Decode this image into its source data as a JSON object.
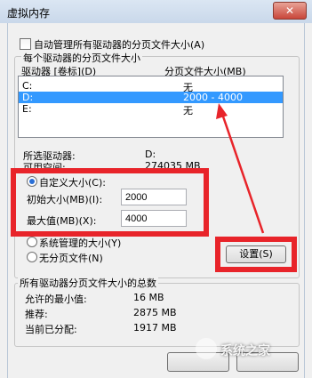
{
  "window": {
    "title": "虚拟内存",
    "close_label": "✕"
  },
  "auto_manage": {
    "label": "自动管理所有驱动器的分页文件大小(A)",
    "checked": false
  },
  "group_drives": {
    "label": "每个驱动器的分页文件大小"
  },
  "columns": {
    "drive": "驱动器 [卷标](D)",
    "size": "分页文件大小(MB)"
  },
  "drives": [
    {
      "drive": "C:",
      "size": "无",
      "selected": false
    },
    {
      "drive": "D:",
      "size": "2000 - 4000",
      "selected": true
    },
    {
      "drive": "E:",
      "size": "无",
      "selected": false
    }
  ],
  "selected_info": {
    "drive_label": "所选驱动器:",
    "drive_value": "D:",
    "space_label": "可用空间:",
    "space_value": "274035 MB"
  },
  "custom_size": {
    "label": "自定义大小(C):",
    "initial_label": "初始大小(MB)(I):",
    "initial_value": "2000",
    "max_label": "最大值(MB)(X):",
    "max_value": "4000"
  },
  "system_managed": {
    "label": "系统管理的大小(Y)"
  },
  "no_paging": {
    "label": "无分页文件(N)"
  },
  "set_button": {
    "label": "设置(S)"
  },
  "totals": {
    "group_label": "所有驱动器分页文件大小的总数",
    "min_label": "允许的最小值:",
    "min_value": "16 MB",
    "rec_label": "推荐:",
    "rec_value": "2875 MB",
    "cur_label": "当前已分配:",
    "cur_value": "1917 MB"
  },
  "watermark": {
    "text": "系统之家"
  },
  "colors": {
    "selection": "#3399ff",
    "annotation_red": "#e8242a"
  }
}
